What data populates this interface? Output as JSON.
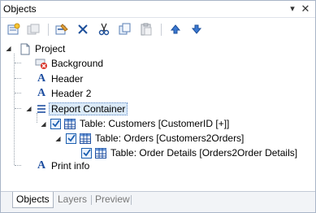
{
  "panel": {
    "title": "Objects",
    "pin_glyph": "▾",
    "close_glyph": "✕"
  },
  "toolbar": {
    "buttons": [
      {
        "name": "new-object-icon",
        "tip": ""
      },
      {
        "name": "copy-disabled-icon",
        "tip": ""
      },
      {
        "name": "properties-icon",
        "tip": ""
      },
      {
        "name": "delete-icon",
        "tip": ""
      },
      {
        "name": "cut-icon",
        "tip": ""
      },
      {
        "name": "copy-icon",
        "tip": ""
      },
      {
        "name": "paste-icon",
        "tip": ""
      },
      {
        "name": "move-up-icon",
        "tip": ""
      },
      {
        "name": "move-down-icon",
        "tip": ""
      }
    ]
  },
  "tree": {
    "project": "Project",
    "background": "Background",
    "header": "Header",
    "header2": "Header 2",
    "report_container": "Report Container",
    "customers": "Table: Customers [CustomerID [+]]",
    "orders": "Table: Orders [Customers2Orders]",
    "order_details": "Table: Order Details [Orders2Order Details]",
    "print_info": "Print info"
  },
  "tabs": [
    {
      "label": "Objects",
      "active": true
    },
    {
      "label": "Layers",
      "active": false
    },
    {
      "label": "Preview",
      "active": false
    }
  ],
  "colors": {
    "accent": "#1c5fb0",
    "text_icon_blue": "#1f4fa0",
    "selection": "#dbeaf8"
  }
}
